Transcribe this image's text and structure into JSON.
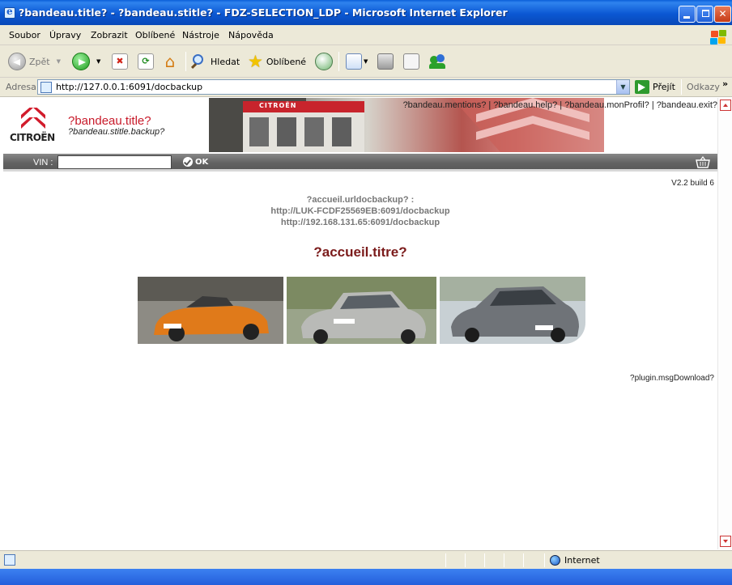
{
  "window": {
    "title": "?bandeau.title? - ?bandeau.stitle? - FDZ-SELECTION_LDP - Microsoft Internet Explorer",
    "minimize_icon": "minimize-icon",
    "maximize_icon": "maximize-icon",
    "close_icon": "close-icon"
  },
  "menu": {
    "items": [
      "Soubor",
      "Úpravy",
      "Zobrazit",
      "Oblíbené",
      "Nástroje",
      "Nápověda"
    ]
  },
  "toolbar": {
    "back_label": "Zpět",
    "search_label": "Hledat",
    "favorites_label": "Oblíbené"
  },
  "address": {
    "label": "Adresa",
    "url": "http://127.0.0.1:6091/docbackup",
    "go_label": "Přejít",
    "links_label": "Odkazy",
    "links_more": "»"
  },
  "banner": {
    "brand": "CITROËN",
    "title": "?bandeau.title?",
    "subtitle": "?bandeau.stitle.backup?",
    "nav": [
      "?bandeau.mentions?",
      "?bandeau.help?",
      "?bandeau.monProfil?",
      "?bandeau.exit?"
    ],
    "nav_separator": " | ",
    "shop_sign": "CITROËN"
  },
  "vinbar": {
    "label": "VIN :",
    "value": "",
    "ok_label": "OK"
  },
  "main": {
    "version": "V2.2 build 6",
    "url_label": "?accueil.urldocbackup? :",
    "url1": "http://LUK-FCDF25569EB:6091/docbackup",
    "url2": "http://192.168.131.65:6091/docbackup",
    "page_title": "?accueil.titre?",
    "plugin_msg": "?plugin.msgDownload?"
  },
  "status": {
    "zone": "Internet"
  },
  "colors": {
    "title_red": "#c81a2a",
    "heading_maroon": "#7b1b1b",
    "vinbar_gray": "#666666",
    "xp_blue": "#0b58d3"
  }
}
